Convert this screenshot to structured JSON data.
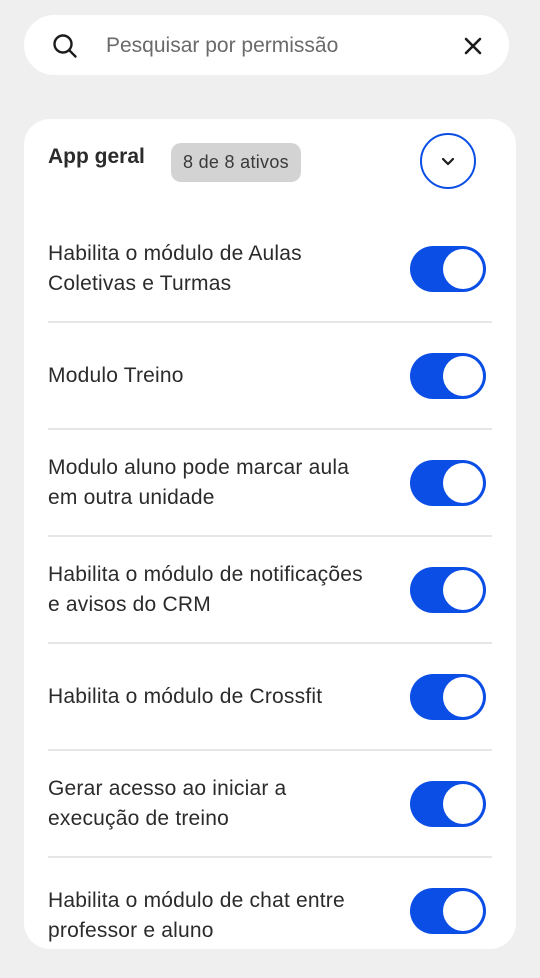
{
  "search": {
    "placeholder": "Pesquisar por permissão",
    "value": "",
    "search_icon": "search-icon",
    "clear_icon": "close-icon"
  },
  "group": {
    "title": "App geral",
    "badge": "8 de 8 ativos",
    "toggle_icon": "chevron-down-icon",
    "accent_color": "#0b4ee6"
  },
  "permissions": [
    {
      "label": "Habilita o módulo de Aulas Coletivas e Turmas",
      "enabled": true
    },
    {
      "label": "Modulo Treino",
      "enabled": true
    },
    {
      "label": "Modulo aluno pode marcar aula em outra unidade",
      "enabled": true
    },
    {
      "label": "Habilita o módulo de notificações e avisos do CRM",
      "enabled": true
    },
    {
      "label": "Habilita o módulo de Crossfit",
      "enabled": true
    },
    {
      "label": "Gerar acesso ao iniciar a execução de treino",
      "enabled": true
    },
    {
      "label": "Habilita o módulo de chat entre professor e aluno",
      "enabled": true
    }
  ]
}
